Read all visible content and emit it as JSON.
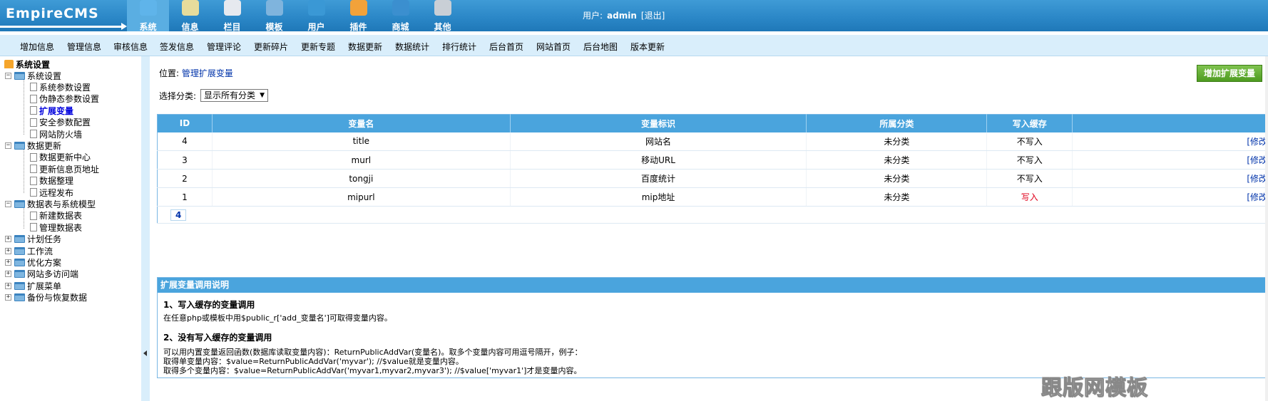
{
  "logo": {
    "text": "EmpireCMS"
  },
  "topnav": [
    {
      "label": "系统",
      "icon": "globe-icon",
      "color": "#5fb4ea",
      "active": true
    },
    {
      "label": "信息",
      "icon": "notepad-icon",
      "color": "#e6dc9c",
      "active": false
    },
    {
      "label": "栏目",
      "icon": "folder-icon",
      "color": "#e6e9ef",
      "active": false
    },
    {
      "label": "模板",
      "icon": "template-window-icon",
      "color": "#7fb4dd",
      "active": false
    },
    {
      "label": "用户",
      "icon": "user-icon",
      "color": "#3a98d5",
      "active": false
    },
    {
      "label": "插件",
      "icon": "plugin-icon",
      "color": "#f2a23a",
      "active": false
    },
    {
      "label": "商城",
      "icon": "store-icon",
      "color": "#3b8fcf",
      "active": false
    },
    {
      "label": "其他",
      "icon": "gear-icon",
      "color": "#c9cfd6",
      "active": false
    }
  ],
  "user": {
    "label": "用户:",
    "name": "admin",
    "logout": "[退出]"
  },
  "menubar": [
    "增加信息",
    "管理信息",
    "审核信息",
    "签发信息",
    "管理评论",
    "更新碎片",
    "更新专题",
    "数据更新",
    "数据统计",
    "排行统计",
    "后台首页",
    "网站首页",
    "后台地图",
    "版本更新"
  ],
  "sidebar": {
    "root": "系统设置",
    "groups": [
      {
        "label": "系统设置",
        "children": [
          "系统参数设置",
          "伪静态参数设置",
          "扩展变量",
          "安全参数配置",
          "网站防火墙"
        ]
      },
      {
        "label": "数据更新",
        "children": [
          "数据更新中心",
          "更新信息页地址",
          "数据整理",
          "远程发布"
        ]
      },
      {
        "label": "数据表与系统模型",
        "children": [
          "新建数据表",
          "管理数据表"
        ]
      },
      {
        "label": "计划任务",
        "children": []
      },
      {
        "label": "工作流",
        "children": []
      },
      {
        "label": "优化方案",
        "children": []
      },
      {
        "label": "网站多访问端",
        "children": []
      },
      {
        "label": "扩展菜单",
        "children": []
      },
      {
        "label": "备份与恢复数据",
        "children": []
      }
    ]
  },
  "main": {
    "location_label": "位置:",
    "location_link": "管理扩展变量",
    "add_button": "增加扩展变量",
    "filter_label": "选择分类:",
    "filter_value": "显示所有分类",
    "columns": [
      "ID",
      "变量名",
      "变量标识",
      "所属分类",
      "写入缓存",
      ""
    ],
    "rows": [
      {
        "id": "4",
        "name": "title",
        "label": "网站名",
        "category": "未分类",
        "cache": "不写入",
        "op": "[修改"
      },
      {
        "id": "3",
        "name": "murl",
        "label": "移动URL",
        "category": "未分类",
        "cache": "不写入",
        "op": "[修改"
      },
      {
        "id": "2",
        "name": "tongji",
        "label": "百度统计",
        "category": "未分类",
        "cache": "不写入",
        "op": "[修改"
      },
      {
        "id": "1",
        "name": "mipurl",
        "label": "mip地址",
        "category": "未分类",
        "cache": "写入",
        "op": "[修改"
      }
    ],
    "pager": "4",
    "help": {
      "title": "扩展变量调用说明",
      "h1": "1、写入缓存的变量调用",
      "p1": "在任意php或模板中用$public_r['add_变量名']可取得变量内容。",
      "h2": "2、没有写入缓存的变量调用",
      "p2": "可以用内置变量返回函数(数据库读取变量内容)：ReturnPublicAddVar(变量名)。取多个变量内容可用逗号隔开，例子：",
      "p3": "取得单变量内容：$value=ReturnPublicAddVar('myvar'); //$value就是变量内容。",
      "p4": "取得多个变量内容：$value=ReturnPublicAddVar('myvar1,myvar2,myvar3'); //$value['myvar1']才是变量内容。"
    }
  },
  "watermark": "跟版网模板"
}
